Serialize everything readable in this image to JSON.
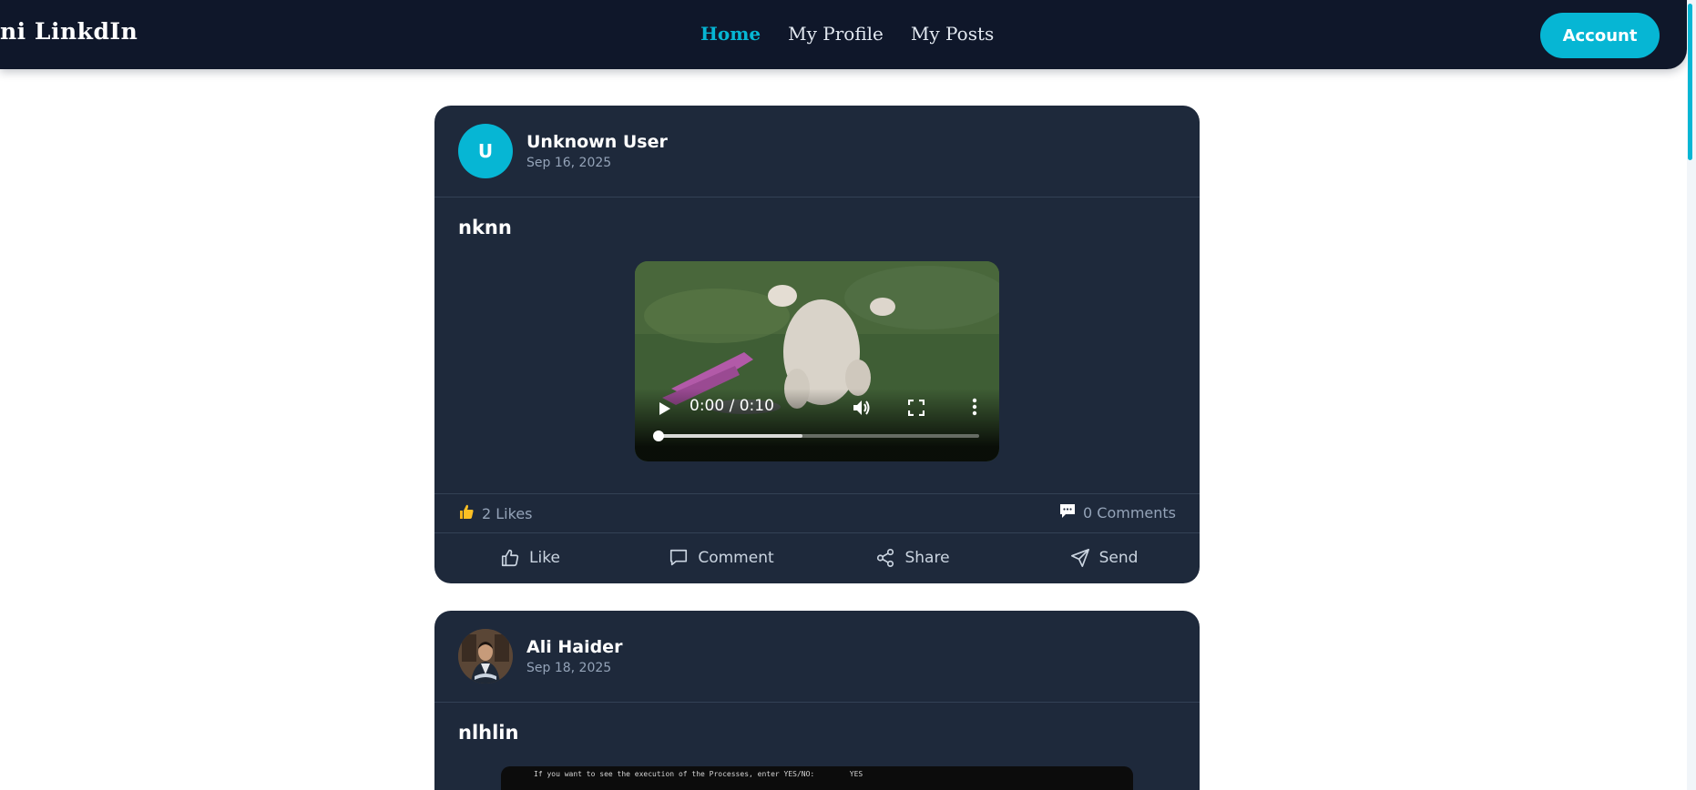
{
  "navbar": {
    "brand": "ini LinkdIn",
    "links": [
      "Home",
      "My Profile",
      "My Posts"
    ],
    "active_link": "Home",
    "account_label": "Account"
  },
  "posts": [
    {
      "author": "Unknown User",
      "avatar_initial": "U",
      "date": "Sep 16, 2025",
      "title": "nknn",
      "media": {
        "type": "video",
        "time": "0:00 / 0:10",
        "progress": 0.0,
        "buffered": 0.45
      },
      "likes_label": "2 Likes",
      "comments_label": "0 Comments"
    },
    {
      "author": "Ali Haider",
      "date": "Sep 18, 2025",
      "title": "nlhlin",
      "media": {
        "type": "image",
        "text": "If you want to see the execution of the Processes, enter YES/NO:        YES"
      }
    }
  ],
  "actions": [
    "Like",
    "Comment",
    "Share",
    "Send"
  ],
  "colors": {
    "navbar_bg": "#0f172a",
    "card_bg": "#1e293b",
    "accent": "#06b6d4",
    "muted_text": "#94a3b8"
  },
  "icons": [
    "thumbs-up-icon",
    "comment-icon",
    "share-icon",
    "send-icon",
    "play-icon",
    "volume-icon",
    "fullscreen-icon",
    "more-vertical-icon"
  ]
}
